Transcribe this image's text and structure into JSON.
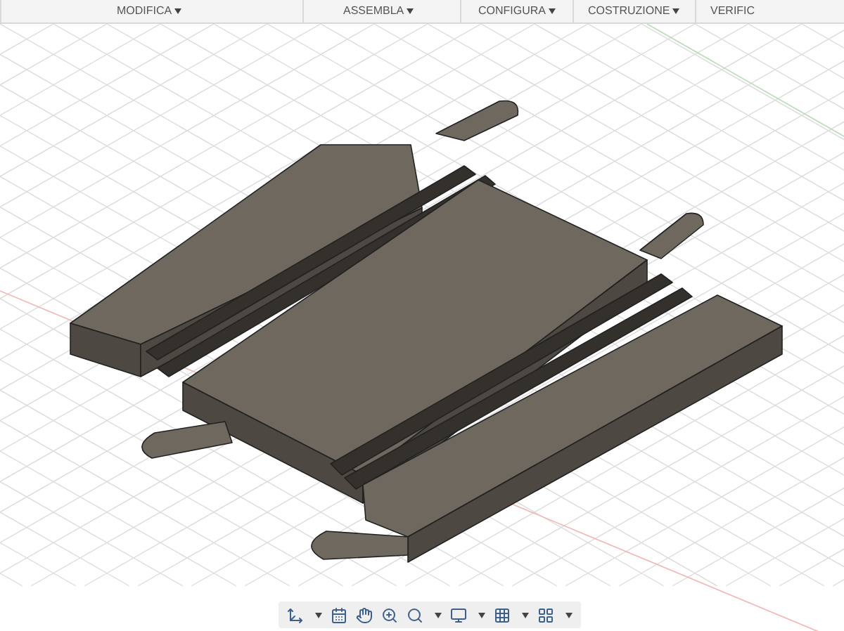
{
  "toolbar": {
    "menus": [
      {
        "label": "MODIFICA",
        "dropdown": true
      },
      {
        "label": "ASSEMBLA",
        "dropdown": true
      },
      {
        "label": "CONFIGURA",
        "dropdown": true
      },
      {
        "label": "COSTRUZIONE",
        "dropdown": true
      },
      {
        "label": "VERIFIC",
        "dropdown": false
      }
    ]
  }
}
